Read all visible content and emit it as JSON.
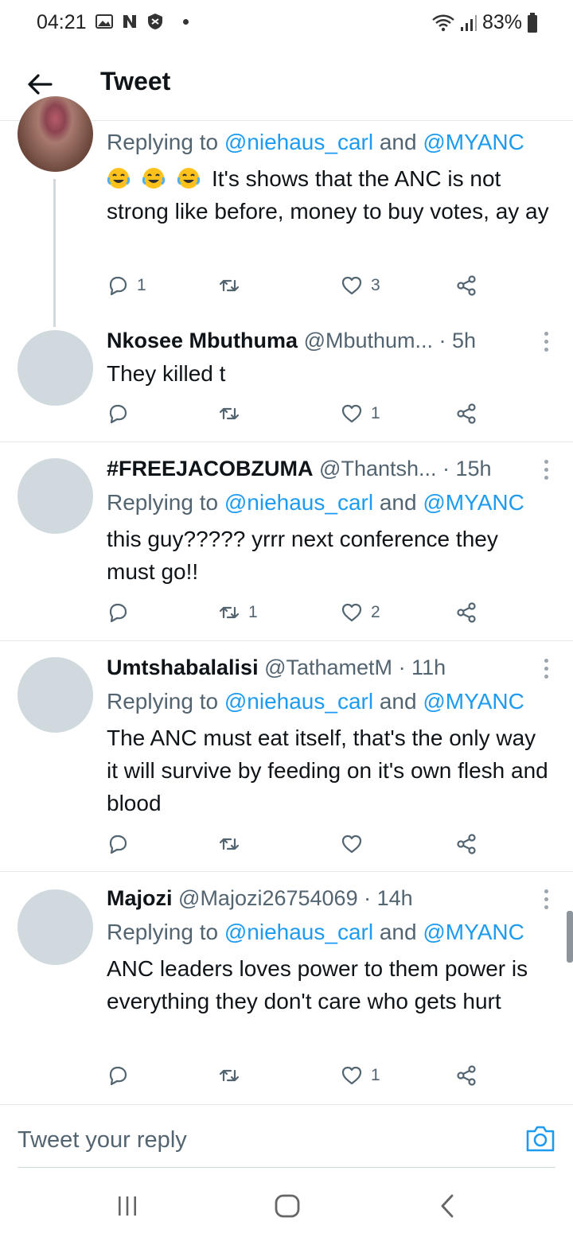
{
  "status_bar": {
    "time": "04:21",
    "battery": "83%",
    "icons": [
      "gallery-icon",
      "n-app-icon",
      "shield-icon",
      "dot-icon",
      "wifi-icon",
      "signal-icon",
      "battery-icon"
    ]
  },
  "header": {
    "title": "Tweet",
    "back_icon": "arrow-left-icon"
  },
  "tweets": [
    {
      "name": "",
      "handle": "",
      "time": "",
      "replying_prefix": "Replying to ",
      "mention1": "@niehaus_carl",
      "and": " and ",
      "mention2": "@MYANC",
      "emoji": [
        "face-with-tears-of-joy",
        "face-with-tears-of-joy",
        "face-with-tears-of-joy"
      ],
      "text": "It's shows that the ANC is not strong like before, money to buy votes, ay ay",
      "replies": "1",
      "retweets": "",
      "likes": "3"
    },
    {
      "name": "Nkosee Mbuthuma",
      "handle": "@Mbuthum...",
      "time": " · 5h",
      "text": "They killed t",
      "replies": "",
      "retweets": "",
      "likes": "1"
    },
    {
      "name": "#FREEJACOBZUMA",
      "handle": "@Thantsh...",
      "time": " · 15h",
      "replying_prefix": "Replying to ",
      "mention1": "@niehaus_carl",
      "and": " and ",
      "mention2": "@MYANC",
      "text": "this guy????? yrrr next conference they must go!!",
      "replies": "",
      "retweets": "1",
      "likes": "2"
    },
    {
      "name": "Umtshabalalisi",
      "handle": "@TathametM",
      "time": " · 11h",
      "replying_prefix": "Replying to ",
      "mention1": "@niehaus_carl",
      "and": " and ",
      "mention2": "@MYANC",
      "text": "The ANC must eat itself, that's the only way it will survive by feeding on it's own flesh and blood",
      "replies": "",
      "retweets": "",
      "likes": ""
    },
    {
      "name": "Majozi",
      "handle": "@Majozi26754069",
      "time": " · 14h",
      "replying_prefix": "Replying to ",
      "mention1": "@niehaus_carl",
      "and": " and ",
      "mention2": "@MYANC",
      "text": "ANC leaders loves power to them power is everything they don't care who gets hurt",
      "replies": "",
      "retweets": "",
      "likes": "1"
    }
  ],
  "reply_box": {
    "placeholder": "Tweet your reply",
    "camera_icon": "camera-icon"
  },
  "nav_bar": {
    "buttons": [
      "recent-apps-icon",
      "home-icon",
      "back-icon"
    ]
  },
  "colors": {
    "accent": "#1d9bf0",
    "secondary_text": "#536471",
    "avatar_placeholder": "#cfd9de"
  }
}
